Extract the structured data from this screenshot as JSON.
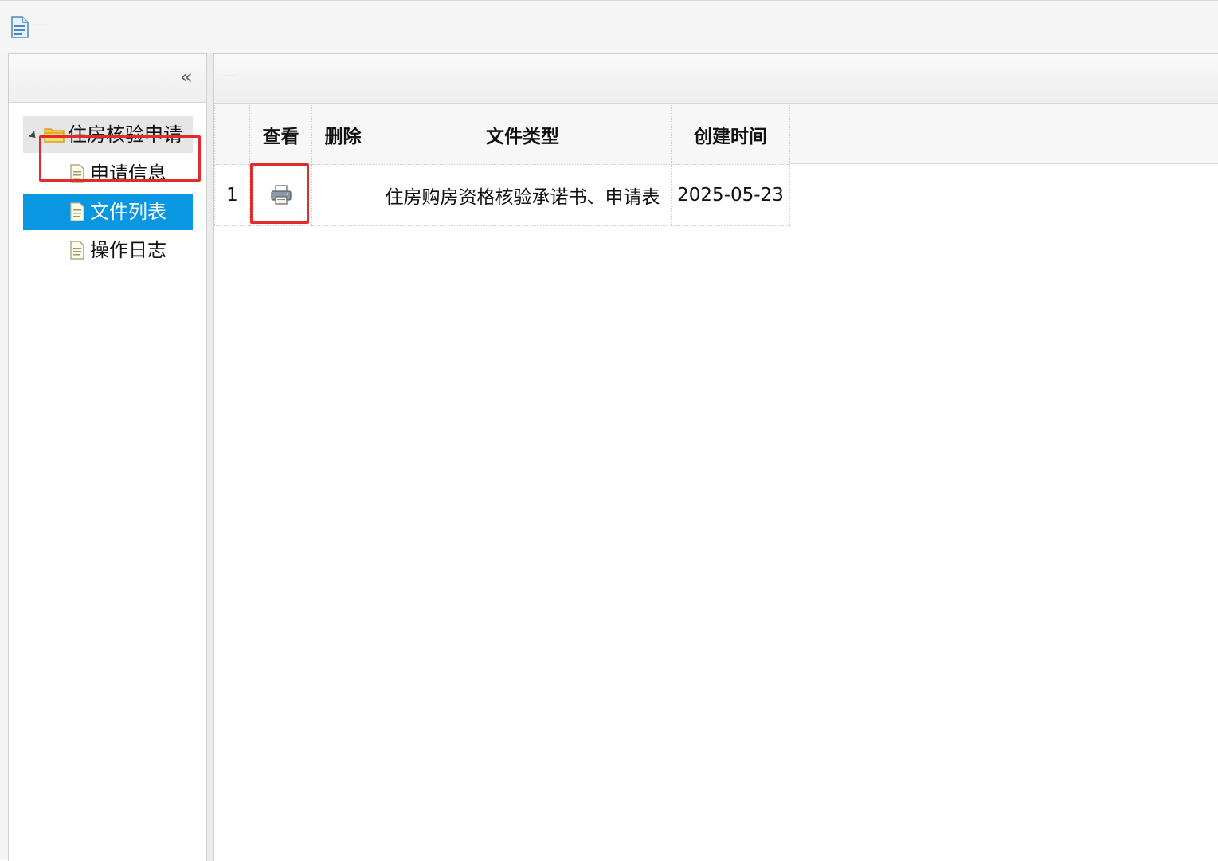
{
  "window": {
    "title": "——"
  },
  "left_panel": {
    "collapse_glyph": "«",
    "tree": {
      "root": {
        "label": "住房核验申请",
        "icon": "folder-icon"
      },
      "children": [
        {
          "label": "申请信息",
          "icon": "document-icon",
          "selected": false
        },
        {
          "label": "文件列表",
          "icon": "document-icon",
          "selected": true
        },
        {
          "label": "操作日志",
          "icon": "document-icon",
          "selected": false
        }
      ]
    }
  },
  "right_panel": {
    "title": "——",
    "grid": {
      "columns": [
        "",
        "查看",
        "删除",
        "文件类型",
        "创建时间"
      ],
      "rows": [
        {
          "index": "1",
          "view_icon": "printer-icon",
          "delete": "",
          "file_type": "住房购房资格核验承诺书、申请表",
          "created": "2025-05-23"
        }
      ]
    }
  },
  "colors": {
    "selected_bg": "#0a97e1",
    "highlight_box": "#e32b2b"
  }
}
